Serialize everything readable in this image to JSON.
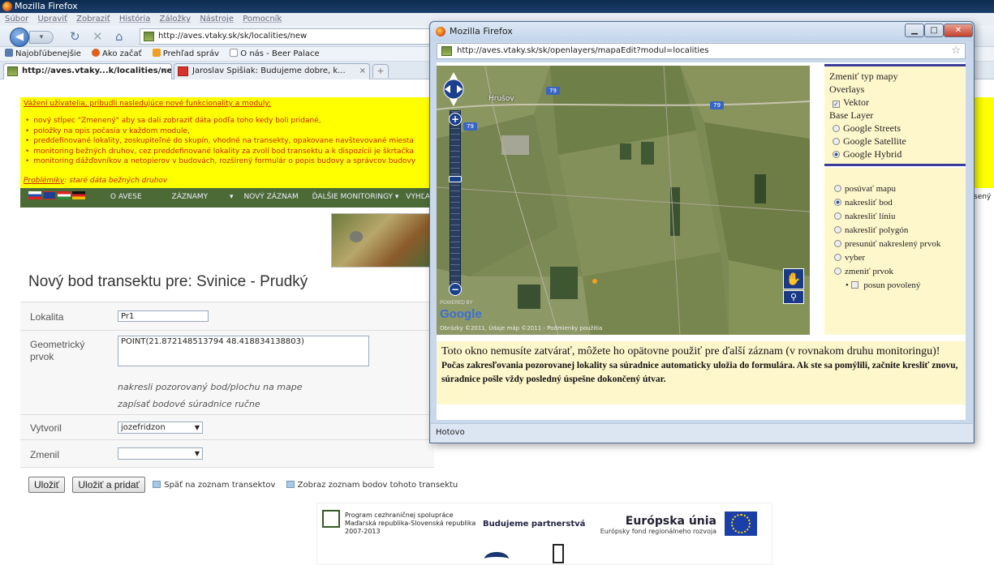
{
  "main_window": {
    "title": "Mozilla Firefox",
    "menu": [
      "Súbor",
      "Upraviť",
      "Zobraziť",
      "História",
      "Záložky",
      "Nástroje",
      "Pomocník"
    ],
    "url": "http://aves.vtaky.sk/sk/localities/new",
    "bookmarks": [
      "Najobľúbenejšie",
      "Ako začať",
      "Prehľad správ",
      "O nás - Beer Palace"
    ],
    "tabs": [
      {
        "label": "http://aves.vtaky...k/localities/new",
        "close": "×"
      },
      {
        "label": "Jaroslav Spišiak: Budujeme dobre, k...",
        "close": "×"
      }
    ],
    "new_tab": "+"
  },
  "notice": {
    "heading": "Vážení užívatelia, pribudli nasledujúce nové funkcionality a moduly:",
    "items": [
      "nový stĺpec \"Zmenený\" aby sa dali zobraziť dáta podľa toho kedy boli pridané,",
      "položky na opis počasia v každom module,",
      "preddefinované lokality, zoskupiteľné do skupín, vhodné na transekty, opakovane navštevované miesta",
      "monitoring bežných druhov, cez preddefinované lokality za zvolí bod transektu a k dispozícii je škrtačka",
      "monitoring dážďovníkov a netopierov v budovách, rozšírený formulár o popis budovy a správcov budovy"
    ],
    "problem_label": "Problémiky",
    "problem_text": ": staré dáta bežných druhov"
  },
  "site_nav": {
    "items": [
      "O AVESE",
      "ZÁZNAMY",
      "NOVÝ ZÁZNAM",
      "ĎALŠIE MONITORINGY",
      "VYHĽADÁVAN"
    ],
    "right_fragment": "sený"
  },
  "page": {
    "title": "Nový bod transektu pre: Svinice - Prudký",
    "lokalita_label": "Lokalita",
    "lokalita_value": "Pr1",
    "geom_label": "Geometrický prvok",
    "geom_value": "POINT(21.872148513794 48.418834138803)",
    "hint1": "nakresli pozorovaný bod/plochu na mape",
    "hint2": "zapísať bodové súradnice ručne",
    "vytvoril_label": "Vytvoril",
    "vytvoril_value": "jozefridzon",
    "zmenil_label": "Zmenil",
    "zmenil_value": "",
    "btn_save": "Uložiť",
    "btn_save_add": "Uložiť a pridať",
    "link_back": "Späť na zoznam transektov",
    "link_points": "Zobraz zoznam bodov tohoto transektu"
  },
  "footer": {
    "program_lines": [
      "Program cezhraničnej spolupráce",
      "Maďarská republika-Slovenská republika",
      "2007-2013"
    ],
    "budujeme": "Budujeme partnerstvá",
    "eu_title": "Európska únia",
    "eu_sub": "Európsky fond regionálneho rozvoja"
  },
  "popup": {
    "title": "Mozilla Firefox",
    "url": "http://aves.vtaky.sk/sk/openlayers/mapaEdit?modul=localities",
    "map": {
      "place_label": "Hrušov",
      "road_numbers": [
        "79",
        "79",
        "79"
      ],
      "google_logo": "Google",
      "powered_by": "POWERED BY",
      "copyright": "Obrázky ©2011, Údaje máp ©2011 - Podmienky použitia"
    },
    "layers": {
      "header": "Zmeniť typ mapy",
      "overlays_label": "Overlays",
      "overlay_vektor": "Vektor",
      "base_label": "Base Layer",
      "base_options": [
        "Google Streets",
        "Google Satellite",
        "Google Hybrid"
      ],
      "base_selected": "Google Hybrid"
    },
    "tools": {
      "options": [
        "posúvať mapu",
        "nakresliť bod",
        "nakresliť líniu",
        "nakresliť polygón",
        "presunúť nakreslený prvok",
        "vyber",
        "zmeniť prvok"
      ],
      "selected": "nakresliť bod",
      "sub_option": "posun povolený"
    },
    "info_big": "Toto okno nemusíte zatvárať, môžete ho opätovne použiť pre ďalší záznam (v rovnakom druhu monitoringu)!",
    "info_bold": "Počas zakresľovania pozorovanej lokality sa súradnice automaticky uložia do formulára. Ak ste sa pomýlili, začnite kresliť znovu, súradnice pošle vždy posledný úspešne dokončený útvar.",
    "status": "Hotovo"
  },
  "colors": {
    "notice_bg": "#ffff00",
    "notice_text": "#cc2200",
    "nav_bg": "#4b6a35",
    "map_panel_bg": "#fff7cc",
    "map_panel_border": "#3b3b99"
  }
}
